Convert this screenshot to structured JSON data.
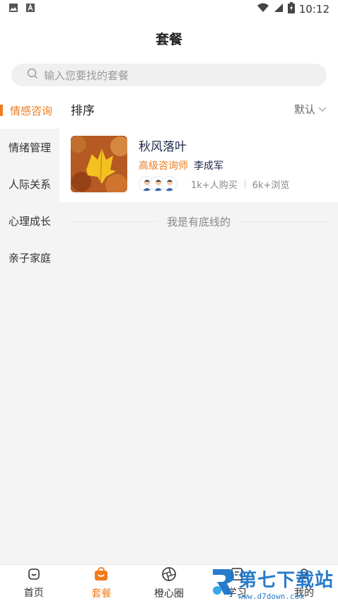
{
  "status_bar": {
    "time": "10:12",
    "left_icons": [
      "image-icon",
      "font-icon"
    ],
    "right_icons": [
      "wifi-icon",
      "signal-icon",
      "battery-icon"
    ]
  },
  "header": {
    "title": "套餐"
  },
  "search": {
    "placeholder": "输入您要找的套餐"
  },
  "sidebar": {
    "items": [
      {
        "label": "情感咨询",
        "active": true
      },
      {
        "label": "情绪管理",
        "active": false
      },
      {
        "label": "人际关系",
        "active": false
      },
      {
        "label": "心理成长",
        "active": false
      },
      {
        "label": "亲子家庭",
        "active": false
      }
    ]
  },
  "sortbar": {
    "title": "排序",
    "option": "默认"
  },
  "packages": [
    {
      "title": "秋风落叶",
      "role": "高级咨询师",
      "advisor": "李成军",
      "buyers": "1k+人购买",
      "views": "6k+浏览"
    }
  ],
  "bottom_line": {
    "text": "我是有底线的"
  },
  "tabbar": {
    "tabs": [
      {
        "label": "首页",
        "icon": "home-icon",
        "active": false
      },
      {
        "label": "套餐",
        "icon": "bag-icon",
        "active": true
      },
      {
        "label": "橙心圈",
        "icon": "aperture-icon",
        "active": false
      },
      {
        "label": "学习",
        "icon": "book-icon",
        "active": false
      },
      {
        "label": "我的",
        "icon": "user-icon",
        "active": false
      }
    ]
  },
  "watermark": {
    "text": "第七下载站",
    "url": "www.d7down.com"
  },
  "colors": {
    "accent": "#f07b1d",
    "title_text": "#1e2a4a",
    "background": "#f4f4f4"
  }
}
